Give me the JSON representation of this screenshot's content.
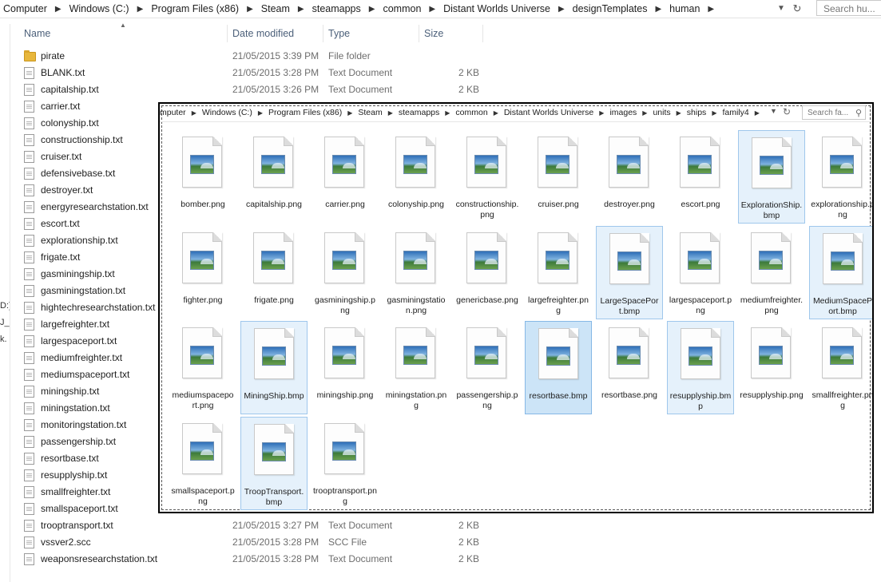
{
  "address": {
    "crumbs": [
      "Computer",
      "Windows (C:)",
      "Program Files (x86)",
      "Steam",
      "steamapps",
      "common",
      "Distant Worlds Universe",
      "designTemplates",
      "human"
    ],
    "search_placeholder": "Search hu..."
  },
  "columns": {
    "name": "Name",
    "date": "Date modified",
    "type": "Type",
    "size": "Size"
  },
  "left_fragments": [
    "D:)",
    "J_",
    "k."
  ],
  "files": [
    {
      "name": "pirate",
      "date": "21/05/2015 3:39 PM",
      "type": "File folder",
      "size": "",
      "kind": "folder"
    },
    {
      "name": "BLANK.txt",
      "date": "21/05/2015 3:28 PM",
      "type": "Text Document",
      "size": "2 KB",
      "kind": "txt"
    },
    {
      "name": "capitalship.txt",
      "date": "21/05/2015 3:26 PM",
      "type": "Text Document",
      "size": "2 KB",
      "kind": "txt"
    },
    {
      "name": "carrier.txt",
      "date": "",
      "type": "",
      "size": "",
      "kind": "txt"
    },
    {
      "name": "colonyship.txt",
      "date": "",
      "type": "",
      "size": "",
      "kind": "txt"
    },
    {
      "name": "constructionship.txt",
      "date": "",
      "type": "",
      "size": "",
      "kind": "txt"
    },
    {
      "name": "cruiser.txt",
      "date": "",
      "type": "",
      "size": "",
      "kind": "txt"
    },
    {
      "name": "defensivebase.txt",
      "date": "",
      "type": "",
      "size": "",
      "kind": "txt"
    },
    {
      "name": "destroyer.txt",
      "date": "",
      "type": "",
      "size": "",
      "kind": "txt"
    },
    {
      "name": "energyresearchstation.txt",
      "date": "",
      "type": "",
      "size": "",
      "kind": "txt"
    },
    {
      "name": "escort.txt",
      "date": "",
      "type": "",
      "size": "",
      "kind": "txt"
    },
    {
      "name": "explorationship.txt",
      "date": "",
      "type": "",
      "size": "",
      "kind": "txt"
    },
    {
      "name": "frigate.txt",
      "date": "",
      "type": "",
      "size": "",
      "kind": "txt"
    },
    {
      "name": "gasminingship.txt",
      "date": "",
      "type": "",
      "size": "",
      "kind": "txt"
    },
    {
      "name": "gasminingstation.txt",
      "date": "",
      "type": "",
      "size": "",
      "kind": "txt"
    },
    {
      "name": "hightechresearchstation.txt",
      "date": "",
      "type": "",
      "size": "",
      "kind": "txt"
    },
    {
      "name": "largefreighter.txt",
      "date": "",
      "type": "",
      "size": "",
      "kind": "txt"
    },
    {
      "name": "largespaceport.txt",
      "date": "",
      "type": "",
      "size": "",
      "kind": "txt"
    },
    {
      "name": "mediumfreighter.txt",
      "date": "",
      "type": "",
      "size": "",
      "kind": "txt"
    },
    {
      "name": "mediumspaceport.txt",
      "date": "",
      "type": "",
      "size": "",
      "kind": "txt"
    },
    {
      "name": "miningship.txt",
      "date": "",
      "type": "",
      "size": "",
      "kind": "txt"
    },
    {
      "name": "miningstation.txt",
      "date": "",
      "type": "",
      "size": "",
      "kind": "txt"
    },
    {
      "name": "monitoringstation.txt",
      "date": "",
      "type": "",
      "size": "",
      "kind": "txt"
    },
    {
      "name": "passengership.txt",
      "date": "",
      "type": "",
      "size": "",
      "kind": "txt"
    },
    {
      "name": "resortbase.txt",
      "date": "",
      "type": "",
      "size": "",
      "kind": "txt"
    },
    {
      "name": "resupplyship.txt",
      "date": "",
      "type": "",
      "size": "",
      "kind": "txt"
    },
    {
      "name": "smallfreighter.txt",
      "date": "",
      "type": "",
      "size": "",
      "kind": "txt"
    },
    {
      "name": "smallspaceport.txt",
      "date": "",
      "type": "",
      "size": "",
      "kind": "txt"
    },
    {
      "name": "trooptransport.txt",
      "date": "21/05/2015 3:27 PM",
      "type": "Text Document",
      "size": "2 KB",
      "kind": "txt"
    },
    {
      "name": "vssver2.scc",
      "date": "21/05/2015 3:28 PM",
      "type": "SCC File",
      "size": "2 KB",
      "kind": "txt"
    },
    {
      "name": "weaponsresearchstation.txt",
      "date": "21/05/2015 3:28 PM",
      "type": "Text Document",
      "size": "2 KB",
      "kind": "txt"
    }
  ],
  "overlay": {
    "crumbs": [
      "mputer",
      "Windows (C:)",
      "Program Files (x86)",
      "Steam",
      "steamapps",
      "common",
      "Distant Worlds Universe",
      "images",
      "units",
      "ships",
      "family4"
    ],
    "search_placeholder": "Search fa...",
    "tiles": [
      {
        "label": "bomber.png",
        "sel": false
      },
      {
        "label": "capitalship.png",
        "sel": false
      },
      {
        "label": "carrier.png",
        "sel": false
      },
      {
        "label": "colonyship.png",
        "sel": false
      },
      {
        "label": "constructionship.png",
        "sel": false
      },
      {
        "label": "cruiser.png",
        "sel": false
      },
      {
        "label": "destroyer.png",
        "sel": false
      },
      {
        "label": "escort.png",
        "sel": false
      },
      {
        "label": "ExplorationShip.bmp",
        "sel": true
      },
      {
        "label": "explorationship.png",
        "sel": false
      },
      {
        "label": "fighter.png",
        "sel": false
      },
      {
        "label": "frigate.png",
        "sel": false
      },
      {
        "label": "gasminingship.png",
        "sel": false
      },
      {
        "label": "gasminingstation.png",
        "sel": false
      },
      {
        "label": "genericbase.png",
        "sel": false
      },
      {
        "label": "largefreighter.png",
        "sel": false
      },
      {
        "label": "LargeSpacePort.bmp",
        "sel": true
      },
      {
        "label": "largespaceport.png",
        "sel": false
      },
      {
        "label": "mediumfreighter.png",
        "sel": false
      },
      {
        "label": "MediumSpacePort.bmp",
        "sel": true
      },
      {
        "label": "mediumspaceport.png",
        "sel": false
      },
      {
        "label": "MiningShip.bmp",
        "sel": true
      },
      {
        "label": "miningship.png",
        "sel": false
      },
      {
        "label": "miningstation.png",
        "sel": false
      },
      {
        "label": "passengership.png",
        "sel": false
      },
      {
        "label": "resortbase.bmp",
        "sel": true,
        "strong": true
      },
      {
        "label": "resortbase.png",
        "sel": false
      },
      {
        "label": "resupplyship.bmp",
        "sel": true
      },
      {
        "label": "resupplyship.png",
        "sel": false
      },
      {
        "label": "smallfreighter.png",
        "sel": false
      },
      {
        "label": "smallspaceport.png",
        "sel": false
      },
      {
        "label": "TroopTransport.bmp",
        "sel": true
      },
      {
        "label": "trooptransport.png",
        "sel": false
      }
    ]
  }
}
